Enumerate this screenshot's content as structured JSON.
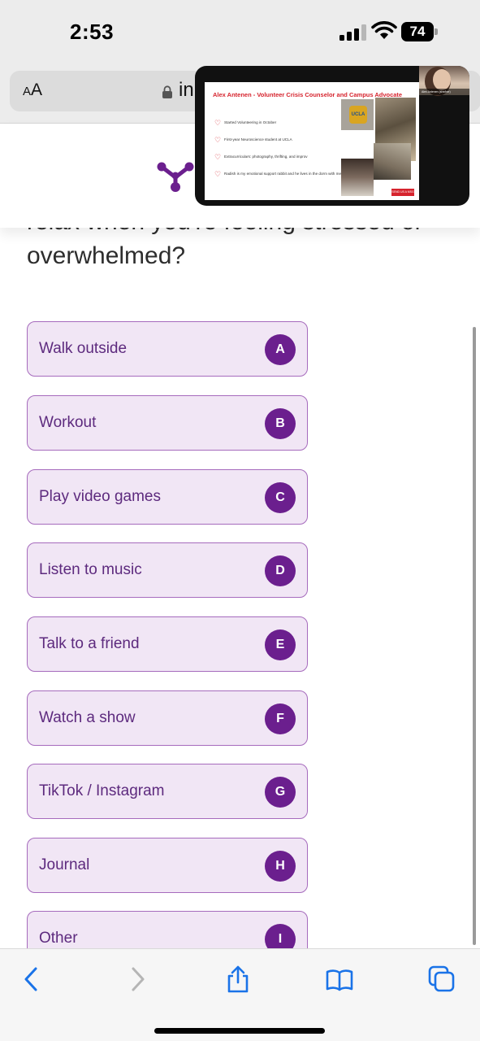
{
  "status_bar": {
    "time": "2:53",
    "battery": "74",
    "signal_bars_active": 3,
    "signal_bars_total": 4
  },
  "browser": {
    "aa_label_small": "A",
    "aa_label_large": "A",
    "url_text": "inp"
  },
  "question": {
    "text": "relax when you're feeling stressed or overwhelmed?"
  },
  "options": [
    {
      "label": "Walk outside",
      "key": "A"
    },
    {
      "label": "Workout",
      "key": "B"
    },
    {
      "label": "Play video games",
      "key": "C"
    },
    {
      "label": "Listen to music",
      "key": "D"
    },
    {
      "label": "Talk to a friend",
      "key": "E"
    },
    {
      "label": "Watch a show",
      "key": "F"
    },
    {
      "label": "TikTok / Instagram",
      "key": "G"
    },
    {
      "label": "Journal",
      "key": "H"
    },
    {
      "label": "Other",
      "key": "I"
    }
  ],
  "pip": {
    "slide_title": "Alex Antenen - Volunteer Crisis Counselor and Campus Advocate",
    "bullets": [
      "Started Volunteering in October",
      "First-year Neuroscience student at UCLA",
      "Extracurriculars: photography, thrifting, and improv",
      "Radish is my emotional support rabbit and he lives in the dorm with me!"
    ],
    "badge_text": "UCLA",
    "webcam_name": "Alex Antenen (she/her)",
    "slide_button": "SEND US A MSG"
  },
  "toolbar": {
    "back_icon": "chevron-left-icon",
    "forward_icon": "chevron-right-icon",
    "share_icon": "share-icon",
    "bookmarks_icon": "book-icon",
    "tabs_icon": "tabs-icon"
  },
  "colors": {
    "accent": "#6b1f8e",
    "option_bg": "#f1e6f5",
    "option_border": "#a66bbd",
    "option_text": "#5d2a7e",
    "ios_blue": "#1a73e8",
    "slide_red": "#d6242e"
  }
}
